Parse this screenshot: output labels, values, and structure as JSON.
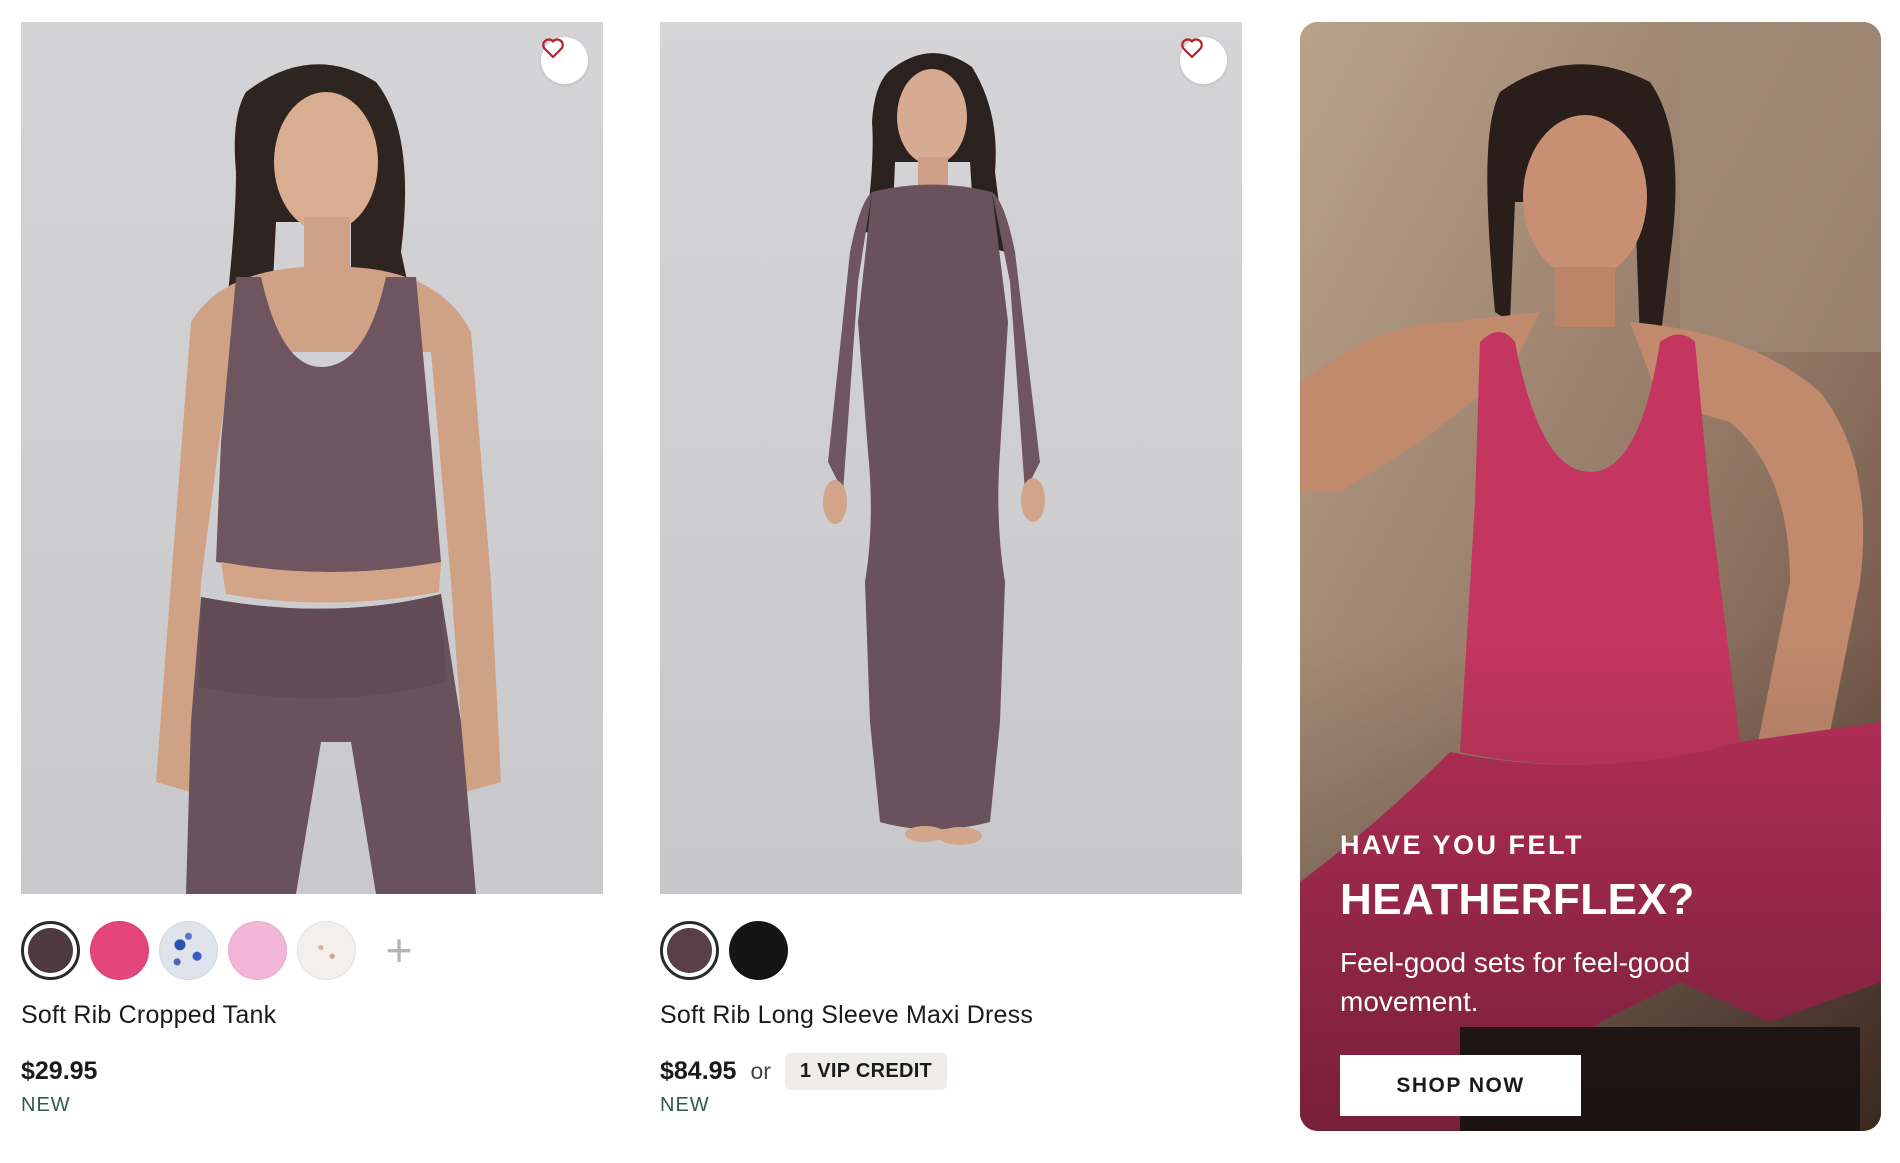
{
  "products": [
    {
      "name": "Soft Rib Cropped Tank",
      "price": "$29.95",
      "badge": "NEW",
      "image_icon": "model-in-cropped-tank-photo",
      "swatches": [
        {
          "color": "#4e3a40",
          "selected": true
        },
        {
          "color": "#e4457a",
          "selected": false
        },
        {
          "color": "#d7dce6",
          "selected": false,
          "pattern": "blue-print"
        },
        {
          "color": "#f2b6d6",
          "selected": false
        },
        {
          "color": "#f3efec",
          "selected": false,
          "pattern": "speckle"
        }
      ],
      "more_swatches_label": "+"
    },
    {
      "name": "Soft Rib Long Sleeve Maxi Dress",
      "price": "$84.95",
      "or_text": "or",
      "vip_credit": "1 VIP CREDIT",
      "badge": "NEW",
      "image_icon": "model-in-maxi-dress-photo",
      "swatches": [
        {
          "color": "#5a3f48",
          "selected": true
        },
        {
          "color": "#141414",
          "selected": false
        }
      ]
    }
  ],
  "promo": {
    "kicker": "HAVE YOU FELT",
    "headline": "HEATHERFLEX?",
    "subtext": "Feel-good sets for feel-good movement.",
    "cta": "SHOP NOW",
    "image_icon": "model-in-pink-bodysuit-photo"
  },
  "colors": {
    "product_fabric": "#6e5560",
    "promo_fabric": "#c4365f",
    "badge_green": "#2f5a4f",
    "vip_bg": "#efede8"
  }
}
